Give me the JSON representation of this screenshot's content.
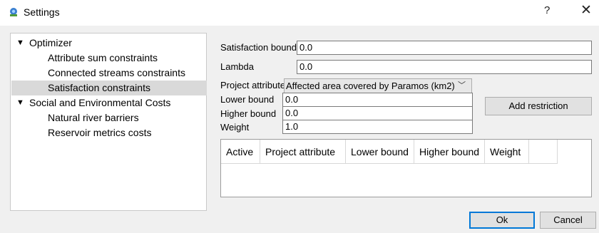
{
  "window": {
    "title": "Settings",
    "help_label": "?",
    "close_label": "✕"
  },
  "tree": {
    "items": [
      {
        "label": "Optimizer",
        "expanded": true
      },
      {
        "label": "Attribute sum constraints"
      },
      {
        "label": "Connected streams constraints"
      },
      {
        "label": "Satisfaction constraints",
        "selected": true
      },
      {
        "label": "Social and Environmental Costs",
        "expanded": true
      },
      {
        "label": "Natural river barriers"
      },
      {
        "label": "Reservoir metrics costs"
      }
    ]
  },
  "form": {
    "satisfaction_bound": {
      "label": "Satisfaction bound",
      "value": "0.0"
    },
    "lambda": {
      "label": "Lambda",
      "value": "0.0"
    },
    "project_attribute": {
      "label": "Project attribute",
      "selected": "Affected area covered by Paramos (km2)"
    },
    "lower_bound": {
      "label": "Lower bound",
      "value": "0.0"
    },
    "higher_bound": {
      "label": "Higher bound",
      "value": "0.0"
    },
    "weight": {
      "label": "Weight",
      "value": "1.0"
    },
    "add_restriction_label": "Add restriction"
  },
  "table": {
    "columns": [
      "Active",
      "Project attribute",
      "Lower bound",
      "Higher bound",
      "Weight",
      ""
    ]
  },
  "buttons": {
    "ok": "Ok",
    "cancel": "Cancel"
  }
}
